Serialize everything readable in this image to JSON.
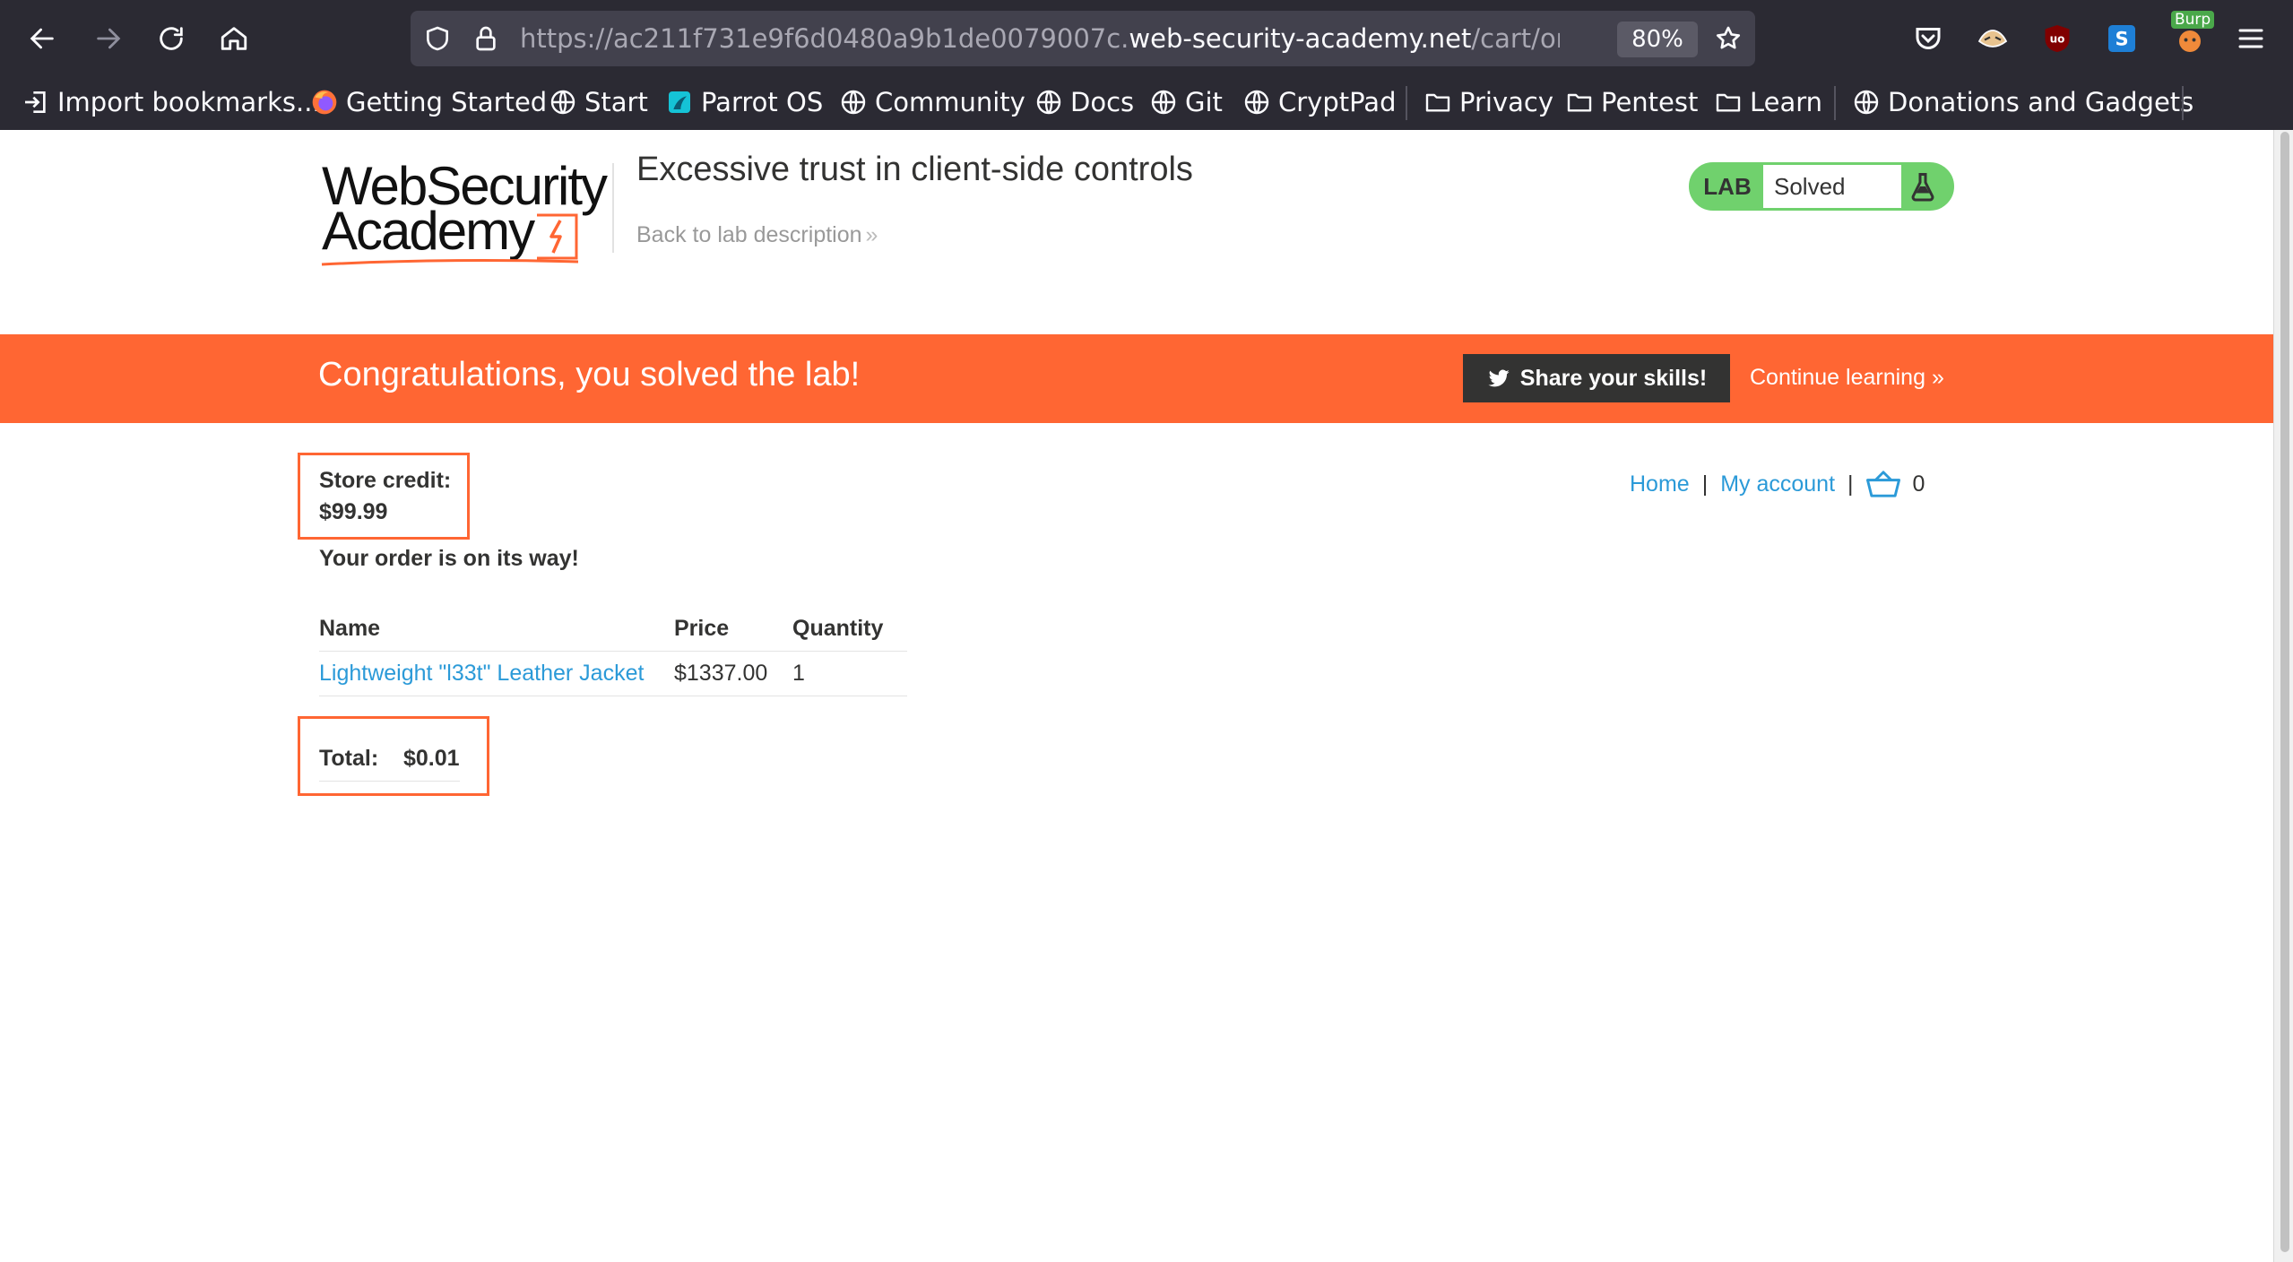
{
  "browser": {
    "url_prefix": "https://ac211f731e9f6d0480a9b1de0079007c.",
    "url_host": "web-security-academy.net",
    "url_path": "/cart/order-co",
    "zoom": "80%",
    "burp_label": "Burp",
    "bookmarks": [
      {
        "label": "Import bookmarks...",
        "icon": "import-icon"
      },
      {
        "label": "Getting Started",
        "icon": "firefox-icon"
      },
      {
        "label": "Start",
        "icon": "globe-icon"
      },
      {
        "label": "Parrot OS",
        "icon": "parrot-icon"
      },
      {
        "label": "Community",
        "icon": "globe-icon"
      },
      {
        "label": "Docs",
        "icon": "globe-icon"
      },
      {
        "label": "Git",
        "icon": "globe-icon"
      },
      {
        "label": "CryptPad",
        "icon": "globe-icon"
      },
      {
        "label": "Privacy",
        "icon": "folder-icon"
      },
      {
        "label": "Pentest",
        "icon": "folder-icon"
      },
      {
        "label": "Learn",
        "icon": "folder-icon"
      },
      {
        "label": "Donations and Gadgets",
        "icon": "globe-icon"
      }
    ]
  },
  "header": {
    "logo_line1": "WebSecurity",
    "logo_line2": "Academy",
    "lab_title": "Excessive trust in client-side controls",
    "back_link": "Back to lab description",
    "lab_tag": "LAB",
    "lab_status": "Solved"
  },
  "banner": {
    "message": "Congratulations, you solved the lab!",
    "share_label": "Share your skills!",
    "continue_label": "Continue learning"
  },
  "nav": {
    "home": "Home",
    "separator": "|",
    "account": "My account",
    "cart_count": "0"
  },
  "store": {
    "credit_label": "Store credit:",
    "credit_value": "$99.99",
    "order_message": "Your order is on its way!"
  },
  "order": {
    "columns": [
      "Name",
      "Price",
      "Quantity"
    ],
    "rows": [
      {
        "name": "Lightweight \"l33t\" Leather Jacket",
        "price": "$1337.00",
        "quantity": "1"
      }
    ],
    "total_label": "Total:",
    "total_value": "$0.01"
  },
  "colors": {
    "accent": "#ff6633",
    "lab_green": "#70d16d",
    "link": "#2b9ad8",
    "chrome_bg": "#2b2a33"
  }
}
